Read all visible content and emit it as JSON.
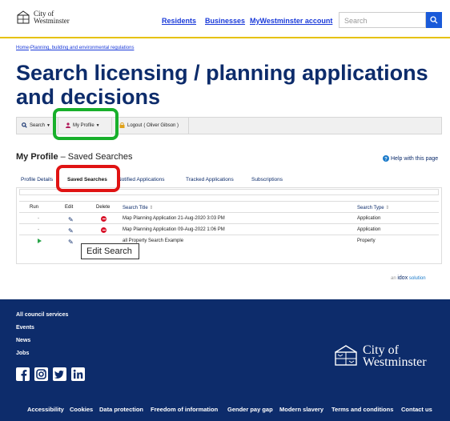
{
  "header": {
    "logo_line1": "City of",
    "logo_line2": "Westminster",
    "nav": [
      "Residents",
      "Businesses",
      "MyWestminster account"
    ],
    "search_placeholder": "Search"
  },
  "breadcrumb": {
    "home": "Home",
    "separator": "›",
    "section": "Planning, building and environmental regulations"
  },
  "page_title": "Search licensing / planning applications and decisions",
  "toolbar": {
    "search_label": "Search",
    "profile_label": "My Profile",
    "logout_label": "Logout",
    "logout_user": "( Oliver Gibson )"
  },
  "section": {
    "title_bold": "My Profile",
    "title_rest": " – Saved Searches",
    "help": "Help with this page"
  },
  "tabs": [
    "Profile Details",
    "Saved Searches",
    "Notified Applications",
    "Tracked Applications",
    "Subscriptions"
  ],
  "table": {
    "headers": {
      "run": "Run",
      "edit": "Edit",
      "delete": "Delete",
      "title": "Search Title",
      "type": "Search Type"
    },
    "sort_marker": "⇕",
    "rows": [
      {
        "run": "-",
        "title": "Map Planning Application 21-Aug-2020 3:03 PM",
        "type": "Application"
      },
      {
        "run": "-",
        "title": "Map Planning Application 09-Aug-2022 1:06 PM",
        "type": "Application"
      },
      {
        "run": "",
        "title": "Small Property Search Example",
        "title_visible": "all Property Search Example",
        "type": "Property"
      }
    ]
  },
  "tooltip": "Edit Search",
  "idox": {
    "prefix": "an",
    "brand": "idox",
    "suffix": "solution"
  },
  "footer": {
    "links": [
      "All council services",
      "Events",
      "News",
      "Jobs"
    ],
    "logo_line1": "City of",
    "logo_line2": "Westminster",
    "bottom_links": [
      "Accessibility",
      "Cookies",
      "Data protection",
      "Freedom of information",
      "Gender pay gap",
      "Modern slavery",
      "Terms and conditions",
      "Contact us"
    ]
  },
  "colors": {
    "brand_navy": "#0d2c6b",
    "accent_yellow": "#e6c200",
    "link_blue": "#1a3ad9",
    "highlight_green": "#18b02b",
    "highlight_red": "#e01313"
  }
}
